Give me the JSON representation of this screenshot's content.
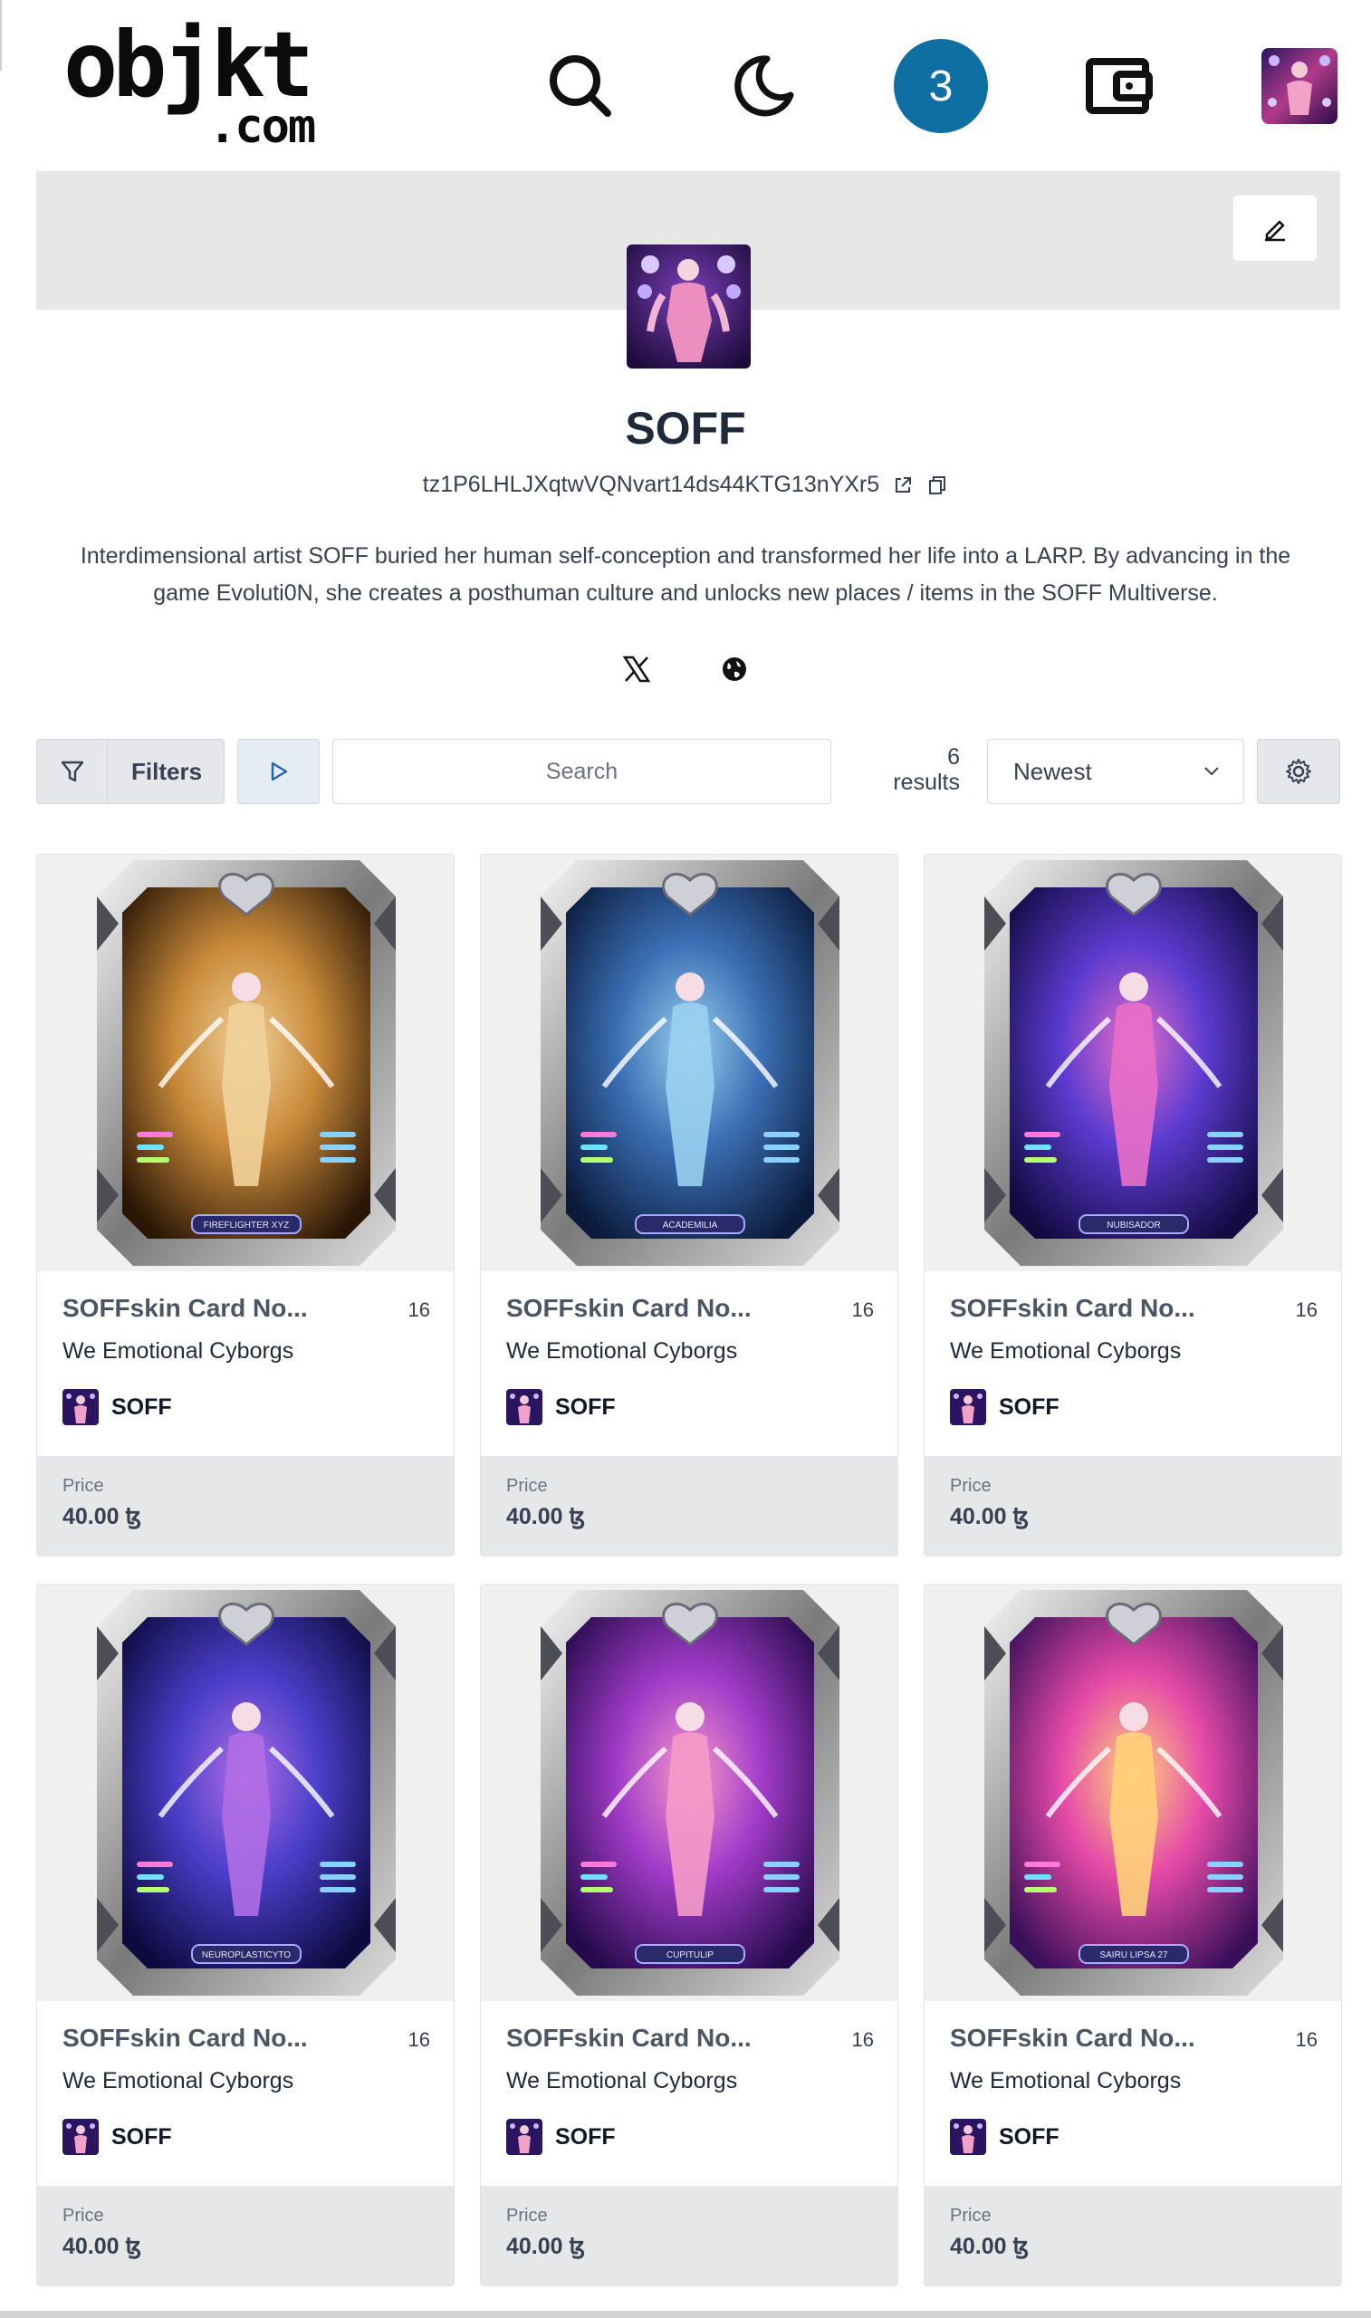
{
  "header": {
    "logo_main": "objkt",
    "logo_sub": ".com",
    "notification_count": "3"
  },
  "profile": {
    "name": "SOFF",
    "address": "tz1P6LHLJXqtwVQNvart14ds44KTG13nYXr5",
    "bio": "Interdimensional artist SOFF buried her human self-conception and transformed her life into a LARP. By advancing in the game Evoluti0N, she creates a posthuman culture and unlocks new places / items in the SOFF Multiverse."
  },
  "toolbar": {
    "filters_label": "Filters",
    "search_placeholder": "Search",
    "results_count": "6",
    "results_label": "results",
    "sort_value": "Newest"
  },
  "cards": [
    {
      "title": "SOFFskin Card No...",
      "editions": "16",
      "collection": "We Emotional Cyborgs",
      "artist": "SOFF",
      "price_label": "Price",
      "price": "40.00 ꜩ",
      "card_name": "FIREFLIGHTER XYZ",
      "colors": [
        "#2a1606",
        "#c98a3a",
        "#f1d29a"
      ]
    },
    {
      "title": "SOFFskin Card No...",
      "editions": "16",
      "collection": "We Emotional Cyborgs",
      "artist": "SOFF",
      "price_label": "Price",
      "price": "40.00 ꜩ",
      "card_name": "ACADEMILIA",
      "colors": [
        "#0a1a3a",
        "#3b6fb5",
        "#9ad0f0"
      ]
    },
    {
      "title": "SOFFskin Card No...",
      "editions": "16",
      "collection": "We Emotional Cyborgs",
      "artist": "SOFF",
      "price_label": "Price",
      "price": "40.00 ꜩ",
      "card_name": "NUBISADOR",
      "colors": [
        "#120a40",
        "#5b3bd0",
        "#e86fc9"
      ]
    },
    {
      "title": "SOFFskin Card No...",
      "editions": "16",
      "collection": "We Emotional Cyborgs",
      "artist": "SOFF",
      "price_label": "Price",
      "price": "40.00 ꜩ",
      "card_name": "NEUROPLASTICYTO",
      "colors": [
        "#0c0a3e",
        "#4a3ec9",
        "#b06ee6"
      ]
    },
    {
      "title": "SOFFskin Card No...",
      "editions": "16",
      "collection": "We Emotional Cyborgs",
      "artist": "SOFF",
      "price_label": "Price",
      "price": "40.00 ꜩ",
      "card_name": "CUPITULIP",
      "colors": [
        "#240a4a",
        "#a23bc9",
        "#f59ac8"
      ]
    },
    {
      "title": "SOFFskin Card No...",
      "editions": "16",
      "collection": "We Emotional Cyborgs",
      "artist": "SOFF",
      "price_label": "Price",
      "price": "40.00 ꜩ",
      "card_name": "SAIRU LIPSA 27",
      "colors": [
        "#3a0f5a",
        "#e64aa8",
        "#ffd27a"
      ]
    }
  ],
  "colors": {
    "accent_badge": "#0f6fa3",
    "banner": "#e7e7e8",
    "card_footer": "#e6e7e9"
  },
  "icons": [
    "search-icon",
    "moon-icon",
    "wallet-icon",
    "edit-icon",
    "external-link-icon",
    "copy-icon",
    "x-icon",
    "globe-icon",
    "filter-icon",
    "play-icon",
    "chevron-down-icon",
    "gear-icon"
  ]
}
